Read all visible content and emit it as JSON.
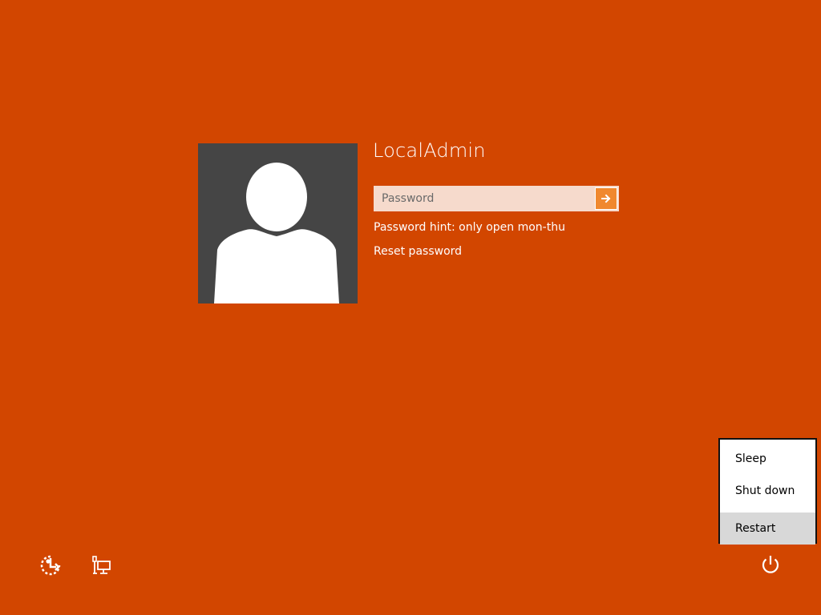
{
  "colors": {
    "background": "#D24600",
    "avatar_bg": "#454545",
    "password_box": "#F6DACC",
    "submit_button": "#F0882E",
    "menu_highlight": "#D8D8D8"
  },
  "account": {
    "username": "LocalAdmin",
    "password_placeholder": "Password",
    "password_hint": "Password hint: only open mon-thu",
    "reset_link": "Reset password"
  },
  "icons": {
    "avatar": "user-silhouette-icon",
    "submit": "arrow-right-icon",
    "ease_of_access": "ease-of-access-icon",
    "network": "network-icon",
    "power": "power-icon"
  },
  "power_menu": {
    "items": [
      {
        "label": "Sleep"
      },
      {
        "label": "Shut down"
      },
      {
        "label": "Restart",
        "highlighted": true
      }
    ]
  }
}
